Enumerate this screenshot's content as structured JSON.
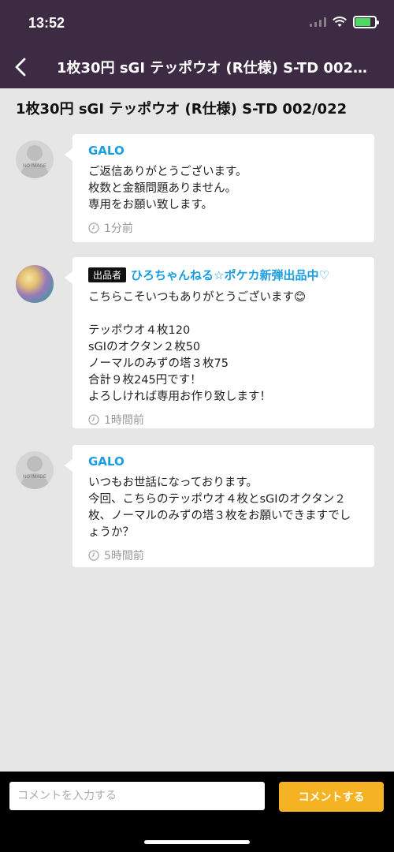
{
  "status_bar": {
    "time": "13:52"
  },
  "nav": {
    "title": "1枚30円 sGI テッポウオ (R仕様) S-TD 002/..."
  },
  "page": {
    "title": "1枚30円 sGI テッポウオ (R仕様) S-TD 002/022"
  },
  "comments": [
    {
      "author": "GALO",
      "avatar": "no-image",
      "avatar_label": "NO IMAGE",
      "body": "ご返信ありがとうございます。\n枚数と金額問題ありません。\n専用をお願い致します。",
      "time": "1分前"
    },
    {
      "author": "ひろちゃんねる☆ポケカ新弾出品中♡",
      "badge": "出品者",
      "avatar": "photo",
      "body": "こちらこそいつもありがとうございます😊\n\nテッポウオ４枚120\nsGIのオクタン２枚50\nノーマルのみずの塔３枚75\n合計９枚245円です！\nよろしければ専用お作り致します！",
      "time": "1時間前"
    },
    {
      "author": "GALO",
      "avatar": "no-image",
      "avatar_label": "NO IMAGE",
      "body": "いつもお世話になっております。\n今回、こちらのテッポウオ４枚とsGIのオクタン２枚、ノーマルのみずの塔３枚をお願いできますでしょうか？",
      "time": "5時間前"
    }
  ],
  "footer": {
    "input_placeholder": "コメントを入力する",
    "button_label": "コメントする"
  },
  "colors": {
    "header_bg": "#3d2a43",
    "author_blue": "#1a9ee0",
    "button_orange": "#f5b324",
    "page_bg": "#e6e6e6"
  },
  "icons": [
    "back-arrow-icon",
    "wifi-icon",
    "battery-charging-icon",
    "clock-icon"
  ]
}
